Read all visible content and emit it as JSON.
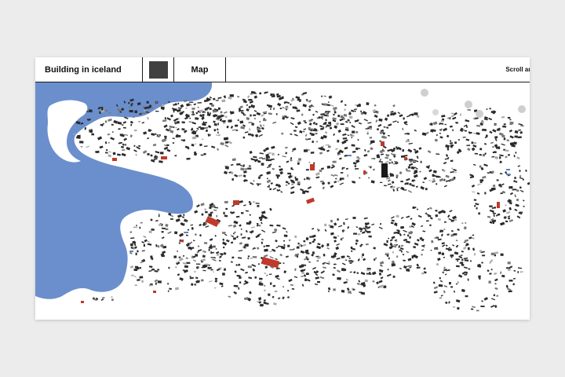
{
  "header": {
    "title": "Building in iceland",
    "swatch_color": "#404040",
    "map_tab_label": "Map",
    "scroll_hint": "Scroll and"
  },
  "map": {
    "water_color": "#6b8fcc",
    "building_color": "#2b2b2b",
    "highlight_color": "#c0392b",
    "accent_blue": "#5a84c4",
    "icons": [
      "building-icon"
    ]
  }
}
